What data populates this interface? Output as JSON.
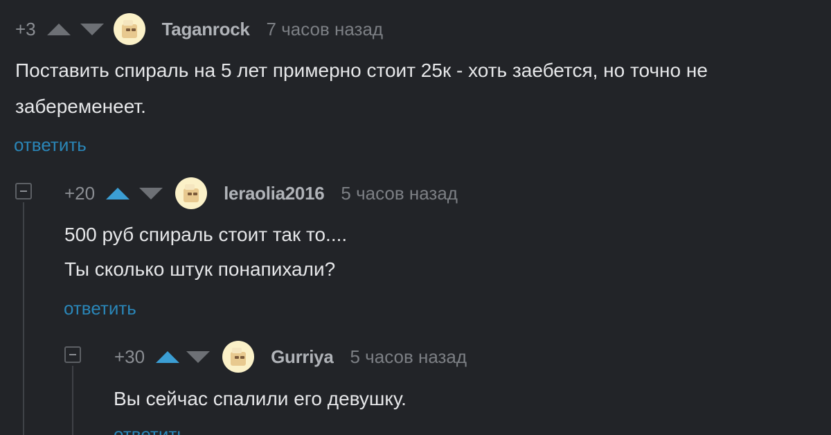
{
  "comments": [
    {
      "rating": "+3",
      "username": "Taganrock",
      "time": "7 часов назад",
      "lines": [
        "Поставить спираль на 5 лет примерно стоит 25к - хоть заебется, но точно не",
        "забеременеет."
      ],
      "reply": "ответить",
      "vote": "none"
    },
    {
      "rating": "+20",
      "username": "leraolia2016",
      "time": "5 часов назад",
      "lines": [
        "500 руб спираль стоит так то....",
        "Ты сколько штук понапихали?"
      ],
      "reply": "ответить",
      "vote": "up"
    },
    {
      "rating": "+30",
      "username": "Gurriya",
      "time": "5 часов назад",
      "lines": [
        "Вы сейчас спалили его девушку."
      ],
      "reply": "ответить",
      "vote": "up"
    }
  ],
  "colors": {
    "background": "#222428",
    "link": "#2a86b8",
    "upvote_active": "#3b9ed4",
    "text": "#e6e7e9"
  },
  "icons": {
    "upvote": "triangle-up-icon",
    "downvote": "triangle-down-icon",
    "collapse": "minus-box-icon",
    "avatar": "default-avatar-icon"
  }
}
